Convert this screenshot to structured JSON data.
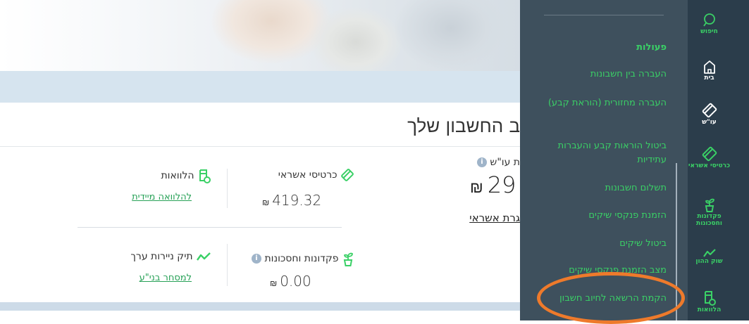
{
  "sidebar": {
    "items": [
      {
        "label": "חיפוש",
        "icon": "search-icon"
      },
      {
        "label": "בית",
        "icon": "home-icon"
      },
      {
        "label": "עו\"ש",
        "icon": "checking-account-icon"
      },
      {
        "label": "כרטיסי אשראי",
        "icon": "credit-card-icon"
      },
      {
        "label": "פקדונות וחסכונות",
        "icon": "savings-plant-icon"
      },
      {
        "label": "שוק ההון",
        "icon": "trend-line-icon"
      },
      {
        "label": "הלוואות",
        "icon": "loan-icon"
      }
    ]
  },
  "menu": {
    "title": "פעולות",
    "items": [
      "העברה בין חשבונות",
      "העברה מחזורית (הוראת קבע)",
      "ביטול הוראות קבע והעברות עתידיות",
      "תשלום חשבונות",
      "הזמנת פנקסי שיקים",
      "ביטול שיקים",
      "מצב הזמנת פנקסי שיקים",
      "הקמת הרשאה לחיוב חשבון"
    ]
  },
  "main": {
    "page_title": "ב החשבון שלך",
    "balance": {
      "label": "ת עו\"ש",
      "amount": "29",
      "currency": "₪",
      "link": "גרת אשראי"
    },
    "tiles": {
      "credit_cards": {
        "label": "כרטיסי אשראי",
        "amount": "419.32",
        "currency": "₪"
      },
      "loans": {
        "label": "הלוואות",
        "link": "להלוואה מיידית"
      },
      "deposits": {
        "label": "פקדונות וחסכונות",
        "amount": "0.00",
        "currency": "₪"
      },
      "securities": {
        "label": "תיק ניירות ערך",
        "link": "למסחר בני\"ע"
      }
    }
  },
  "colors": {
    "accent_green": "#3ad066",
    "menu_bg": "#3e505d",
    "sidebar_bg": "#2b3d4b",
    "highlight_orange": "#ee7a2b"
  }
}
